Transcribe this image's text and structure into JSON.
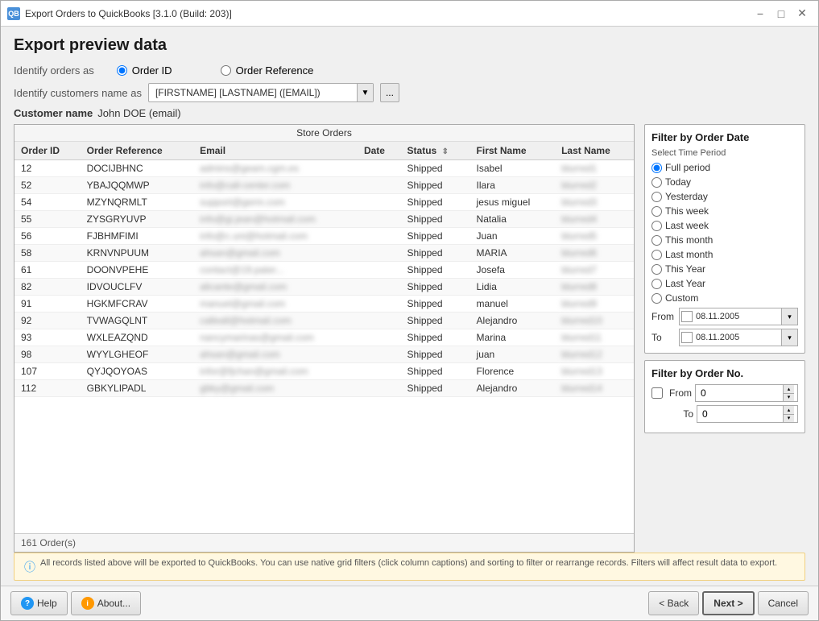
{
  "window": {
    "title": "Export Orders to QuickBooks [3.1.0 (Build: 203)]",
    "icon_text": "QB"
  },
  "page": {
    "title": "Export preview data"
  },
  "identify": {
    "label": "Identify orders as",
    "option1": "Order ID",
    "option2": "Order Reference",
    "selected": "order_id"
  },
  "customer_name_as": {
    "label": "Identify customers name as",
    "value": "[FIRSTNAME] [LASTNAME] ([EMAIL])",
    "button_label": "..."
  },
  "customer": {
    "label": "Customer name",
    "value": "John DOE (email)"
  },
  "table": {
    "store_header": "Store Orders",
    "columns": [
      "Order ID",
      "Order Reference",
      "Email",
      "Date",
      "Status",
      "First Name",
      "Last Name"
    ],
    "rows": [
      {
        "id": "12",
        "ref": "DOCIJBHNC",
        "email": "blurred",
        "date": "",
        "status": "Shipped",
        "first": "Isabel",
        "last": "blurred"
      },
      {
        "id": "52",
        "ref": "YBAJQQMWP",
        "email": "blurred",
        "date": "",
        "status": "Shipped",
        "first": "Ilara",
        "last": "blurred"
      },
      {
        "id": "54",
        "ref": "MZYNQRMLT",
        "email": "blurred",
        "date": "",
        "status": "Shipped",
        "first": "jesus miguel",
        "last": "blurred"
      },
      {
        "id": "55",
        "ref": "ZYSGRYUVP",
        "email": "blurred",
        "date": "",
        "status": "Shipped",
        "first": "Natalia",
        "last": "blurred"
      },
      {
        "id": "56",
        "ref": "FJBHMFIMI",
        "email": "blurred",
        "date": "",
        "status": "Shipped",
        "first": "Juan",
        "last": "blurred"
      },
      {
        "id": "58",
        "ref": "KRNVNPUUM",
        "email": "blurred",
        "date": "",
        "status": "Shipped",
        "first": "MARIA",
        "last": "blurred"
      },
      {
        "id": "61",
        "ref": "DOONVPEHE",
        "email": "blurred",
        "date": "",
        "status": "Shipped",
        "first": "Josefa",
        "last": "blurred"
      },
      {
        "id": "82",
        "ref": "IDVOUCLFV",
        "email": "blurred",
        "date": "",
        "status": "Shipped",
        "first": "Lidia",
        "last": "blurred"
      },
      {
        "id": "91",
        "ref": "HGKMFCRAV",
        "email": "blurred",
        "date": "",
        "status": "Shipped",
        "first": "manuel",
        "last": "blurred"
      },
      {
        "id": "92",
        "ref": "TVWAGQLNT",
        "email": "blurred",
        "date": "",
        "status": "Shipped",
        "first": "Alejandro",
        "last": "blurred"
      },
      {
        "id": "93",
        "ref": "WXLEAZQND",
        "email": "blurred",
        "date": "",
        "status": "Shipped",
        "first": "Marina",
        "last": "blurred"
      },
      {
        "id": "98",
        "ref": "WYYLGHEOF",
        "email": "blurred",
        "date": "",
        "status": "Shipped",
        "first": "juan",
        "last": "blurred"
      },
      {
        "id": "107",
        "ref": "QYJQOYOAS",
        "email": "blurred",
        "date": "",
        "status": "Shipped",
        "first": "Florence",
        "last": "blurred"
      },
      {
        "id": "112",
        "ref": "GBKYLIPADL",
        "email": "blurred",
        "date": "",
        "status": "Shipped",
        "first": "Alejandro",
        "last": "blurred"
      }
    ],
    "footer": "161 Order(s)"
  },
  "filter_date": {
    "title": "Filter by Order Date",
    "time_period_label": "Select Time Period",
    "options": [
      {
        "value": "full_period",
        "label": "Full period",
        "checked": true
      },
      {
        "value": "today",
        "label": "Today",
        "checked": false
      },
      {
        "value": "yesterday",
        "label": "Yesterday",
        "checked": false
      },
      {
        "value": "this_week",
        "label": "This week",
        "checked": false
      },
      {
        "value": "last_week",
        "label": "Last week",
        "checked": false
      },
      {
        "value": "this_month",
        "label": "This month",
        "checked": false
      },
      {
        "value": "last_month",
        "label": "Last month",
        "checked": false
      },
      {
        "value": "this_year",
        "label": "This Year",
        "checked": false
      },
      {
        "value": "last_year",
        "label": "Last Year",
        "checked": false
      },
      {
        "value": "custom",
        "label": "Custom",
        "checked": false
      }
    ],
    "from_label": "From",
    "to_label": "To",
    "from_date": "08.11.2005",
    "to_date": "08.11.2005"
  },
  "filter_order_no": {
    "title": "Filter by Order No.",
    "from_label": "From",
    "to_label": "To",
    "from_value": "0",
    "to_value": "0"
  },
  "info_bar": {
    "text": "All records listed above will be exported to QuickBooks. You can use native grid filters (click column captions) and sorting to filter or rearrange records. Filters will affect result data to export."
  },
  "footer_buttons": {
    "help": "Help",
    "about": "About...",
    "back": "< Back",
    "next": "Next >",
    "cancel": "Cancel"
  }
}
